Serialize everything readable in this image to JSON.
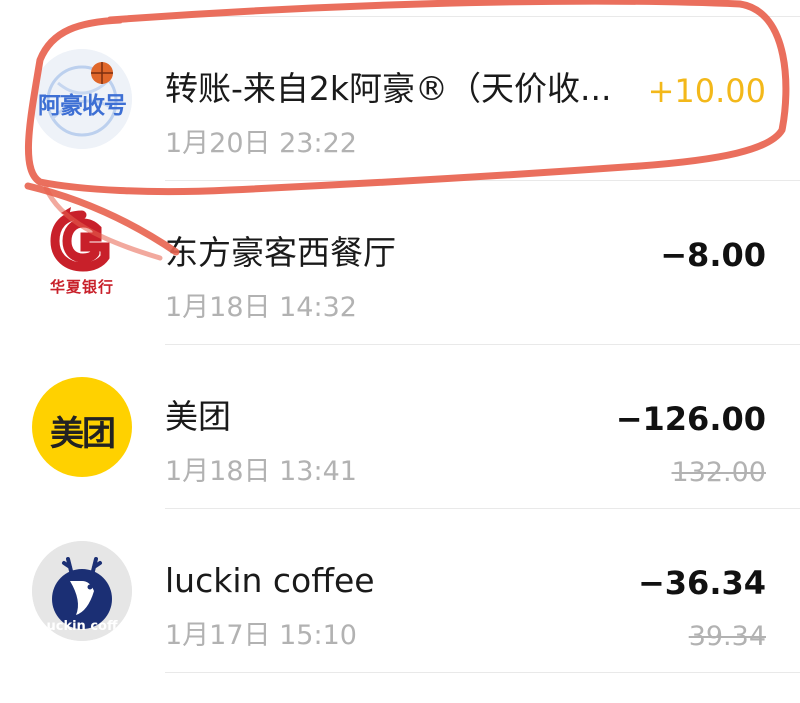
{
  "transactions": [
    {
      "title": "转账-来自2k阿豪®（天价收...",
      "time": "1月20日 23:22",
      "amount": "+10.00",
      "original": "",
      "icon": "basketball-logo-icon",
      "logo_text": "阿豪收号"
    },
    {
      "title": "东方豪客西餐厅",
      "time": "1月18日 14:32",
      "amount": "−8.00",
      "original": "",
      "icon": "hua-xia-bank-logo-icon",
      "logo_text": "华夏银行"
    },
    {
      "title": "美团",
      "time": "1月18日 13:41",
      "amount": "−126.00",
      "original": "132.00",
      "icon": "meituan-logo-icon",
      "logo_text": "美团"
    },
    {
      "title": "luckin coffee",
      "time": "1月17日 15:10",
      "amount": "−36.34",
      "original": "39.34",
      "icon": "luckin-deer-logo-icon",
      "logo_text": "uckin coff"
    }
  ],
  "colors": {
    "income": "#f3b81a",
    "expense": "#111111",
    "secondary_text": "#b2b2b2",
    "annotation": "#e8634f",
    "meituan_yellow": "#ffd100",
    "luckin_blue": "#1b2f74",
    "bank_red": "#c8202a"
  }
}
